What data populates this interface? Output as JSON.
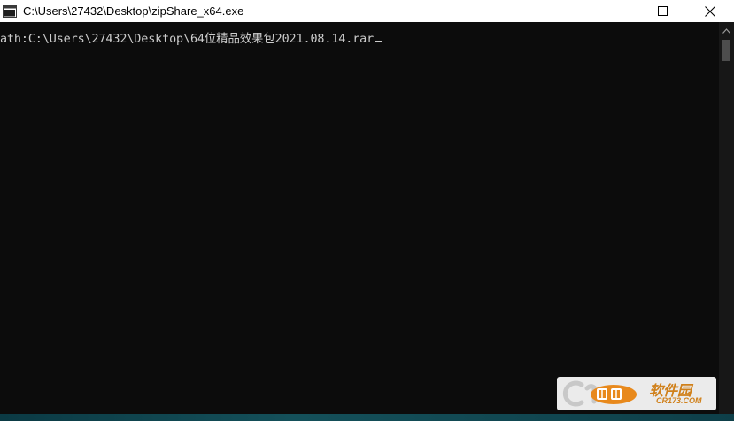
{
  "window": {
    "title": "C:\\Users\\27432\\Desktop\\zipShare_x64.exe",
    "icon": "console-window-icon"
  },
  "caption_buttons": {
    "minimize": "minimize-icon",
    "maximize": "maximize-icon",
    "close": "close-icon"
  },
  "console": {
    "lines": [
      "ath:C:\\Users\\27432\\Desktop\\64位精品效果包2021.08.14.rar"
    ],
    "cursor": "underscore"
  },
  "colors": {
    "console_bg": "#0c0c0c",
    "console_text": "#cccccc",
    "titlebar_bg": "#ffffff",
    "watermark_accent": "#d0801a"
  },
  "watermark": {
    "logo": "cr173-logo",
    "name": "软件园",
    "site": "CR173.COM"
  }
}
